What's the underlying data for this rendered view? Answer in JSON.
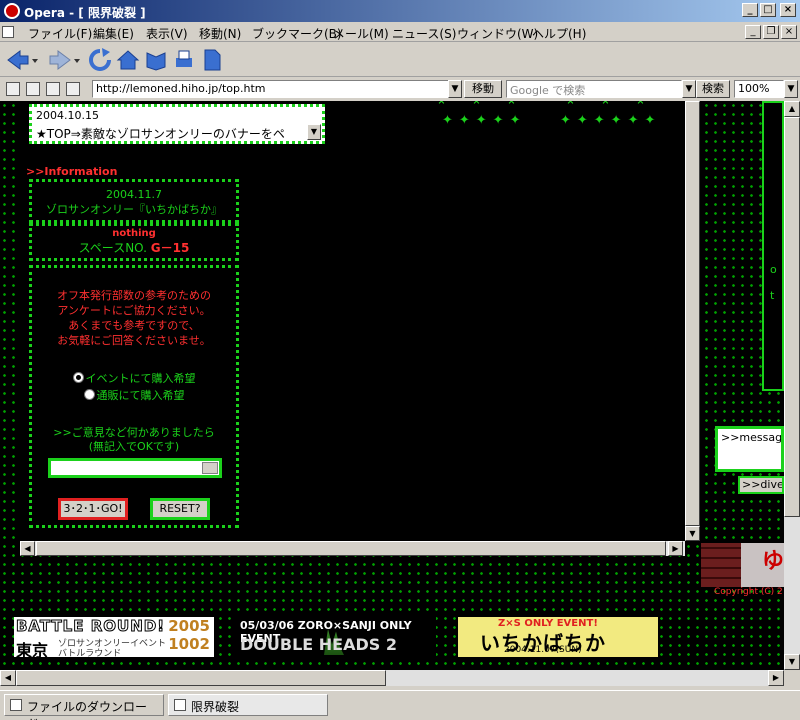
{
  "window": {
    "title": "Opera - [ 限界破裂 ]",
    "controls": {
      "minimize": "_",
      "maximize": "□",
      "close": "×",
      "mdi_minimize": "_",
      "mdi_restore": "❐",
      "mdi_close": "×"
    }
  },
  "menu": [
    "ファイル(F)",
    "編集(E)",
    "表示(V)",
    "移動(N)",
    "ブックマーク(B)",
    "メール(M)",
    "ニュース(S)",
    "ウィンドウ(W)",
    "ヘルプ(H)"
  ],
  "address": {
    "url": "http://lemoned.hiho.jp/top.htm",
    "go_label": "移動",
    "search_placeholder": "Google で検索",
    "search_label": "検索",
    "zoom": "100%"
  },
  "page": {
    "news_line1": "2004.10.15",
    "news_line2": "★TOP⇒素敵なゾロサンオンリーのバナーをペ",
    "info_heading": ">>Information",
    "event_date": "2004.11.7",
    "event_name": "ゾロサンオンリー『いちかばちか』",
    "space_status": "nothing",
    "space_prefix": "スペースNO.",
    "space_number": "G－15",
    "survey_text": [
      "オフ本発行部数の参考のための",
      "アンケートにご協力ください。",
      "あくまでも参考ですので、",
      "お気軽にご回答くださいませ。"
    ],
    "radio_options": [
      "イベントにて購入希望",
      "通販にて購入希望"
    ],
    "comment_prompt": [
      ">>ご意見など何かありましたら",
      "(無記入でOKです)"
    ],
    "submit_label": "3･2･1･GO!",
    "reset_label": "RESET?",
    "right_chars": [
      "o",
      "t"
    ],
    "message_text": ">>message",
    "dive_label": ">>dive",
    "copyright": "Copyright (C) 2",
    "banners": {
      "battle_title": "BATTLE ROUND!",
      "battle_year": "2005",
      "battle_date": "1002",
      "battle_city": "東京",
      "battle_sub1": "ゾロサンオンリーイベント",
      "battle_sub2": "バトルラウンド",
      "double_head": "05/03/06 ZORO×SANJI ONLY EVENT",
      "double_title": "DOUBLE HEADS 2",
      "chika_top": "Z×S ONLY EVENT!",
      "chika_title": "いちかばちか",
      "chika_date": "2004.11.07(SUN)"
    }
  },
  "status_tabs": [
    "ファイルのダウンロード",
    "限界破裂"
  ],
  "colors": {
    "accent_green": "#1bd11b",
    "accent_red": "#ff3030",
    "page_bg": "#000000"
  }
}
